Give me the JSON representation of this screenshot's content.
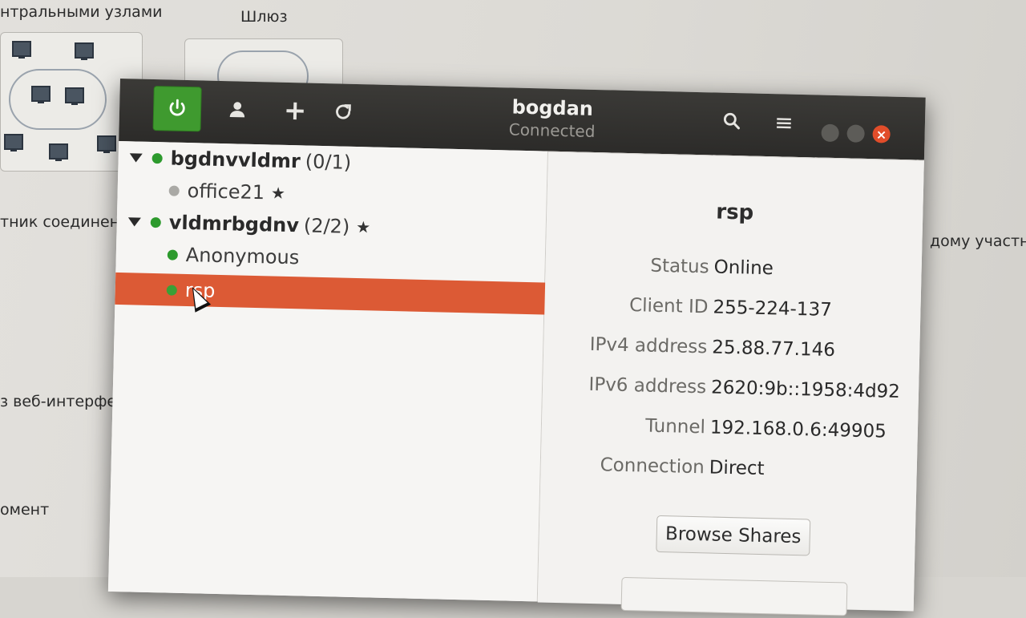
{
  "background": {
    "texts": [
      "нтральными узлами",
      "Шлюз",
      "тник соединен с",
      "дому участни",
      "з веб-интерфе",
      "омент"
    ]
  },
  "window": {
    "title": "bogdan",
    "subtitle": "Connected",
    "accent_color": "#dc5a35",
    "power_color": "#3f9a2f",
    "toolbar": {
      "power_icon": "power-icon",
      "user_icon": "user-icon",
      "add_label": "+",
      "refresh_icon": "refresh-icon",
      "search_icon": "search-icon",
      "menu_label": "≡"
    }
  },
  "networks": [
    {
      "name": "bgdnvvldmr",
      "count": "(0/1)",
      "status": "online",
      "starred": false,
      "members": [
        {
          "name": "office21",
          "status": "offline",
          "starred": true
        }
      ]
    },
    {
      "name": "vldmrbgdnv",
      "count": "(2/2)",
      "status": "online",
      "starred": true,
      "members": [
        {
          "name": "Anonymous",
          "status": "online",
          "starred": false
        },
        {
          "name": "rsp",
          "status": "online",
          "starred": false,
          "selected": true
        }
      ]
    }
  ],
  "details": {
    "title": "rsp",
    "fields": [
      {
        "label": "Status",
        "value": "Online"
      },
      {
        "label": "Client ID",
        "value": "255-224-137"
      },
      {
        "label": "IPv4 address",
        "value": "25.88.77.146"
      },
      {
        "label": "IPv6 address",
        "value": "2620:9b::1958:4d92"
      },
      {
        "label": "Tunnel",
        "value": "192.168.0.6:49905"
      },
      {
        "label": "Connection",
        "value": "Direct"
      }
    ],
    "browse_label": "Browse Shares"
  }
}
